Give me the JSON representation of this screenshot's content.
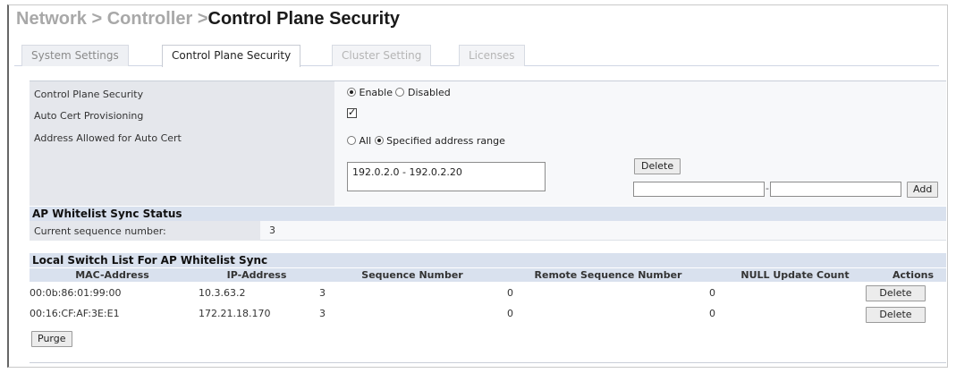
{
  "breadcrumb": {
    "network": "Network",
    "sep1": " > ",
    "controller": "Controller",
    "sep2": " >",
    "current": "Control Plane Security"
  },
  "tabs": [
    {
      "label": "System Settings"
    },
    {
      "label": "Control Plane Security"
    },
    {
      "label": "Cluster Setting"
    },
    {
      "label": "Licenses"
    }
  ],
  "settings": {
    "cps_label": "Control Plane Security",
    "cps_enable": "Enable",
    "cps_disabled": "Disabled",
    "auto_cert_label": "Auto Cert Provisioning",
    "address_label": "Address Allowed for Auto Cert",
    "addr_all": "All",
    "addr_range": "Specified address range",
    "range_value": "192.0.2.0 - 192.0.2.20",
    "delete_label": "Delete",
    "add_label": "Add",
    "range_separator": "-"
  },
  "whitelist_status": {
    "title": "AP Whitelist Sync Status",
    "seq_label": "Current sequence number:",
    "seq_value": "3"
  },
  "switch_list": {
    "title": "Local Switch List For AP Whitelist Sync",
    "columns": [
      "MAC-Address",
      "IP-Address",
      "Sequence Number",
      "Remote Sequence Number",
      "NULL Update Count",
      "Actions"
    ],
    "rows": [
      {
        "mac": "00:0b:86:01:99:00",
        "ip": "10.3.63.2",
        "seq": "3",
        "remote_seq": "0",
        "null_count": "0",
        "action": "Delete"
      },
      {
        "mac": "00:16:CF:AF:3E:E1",
        "ip": "172.21.18.170",
        "seq": "3",
        "remote_seq": "0",
        "null_count": "0",
        "action": "Delete"
      }
    ],
    "purge_label": "Purge"
  }
}
